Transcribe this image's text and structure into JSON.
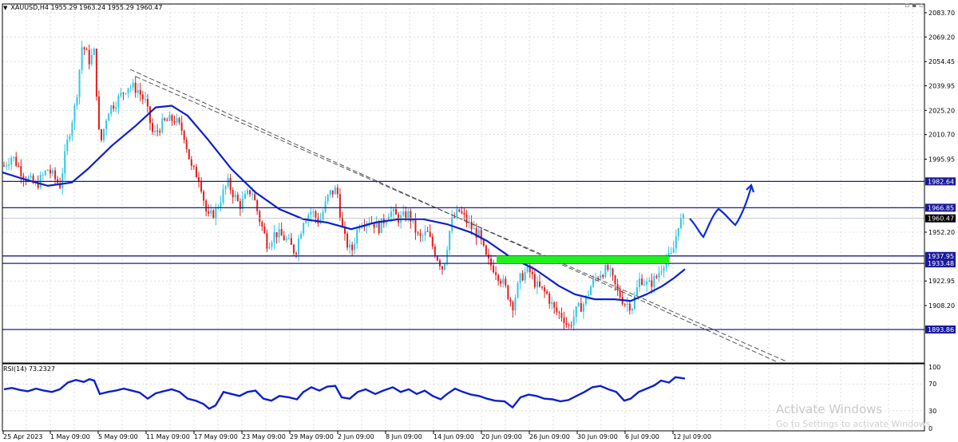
{
  "window": {
    "menu_arrow": "▼",
    "symbol_info": "XAUUSD,H4  1955.29 1963.24 1955.29 1960.47",
    "window_controls": "▫ ▪ ▫",
    "rsi_label": "RSI(14) 73.2327"
  },
  "price_axis": {
    "labels": [
      "2083.70",
      "2069.20",
      "2054.45",
      "2039.95",
      "2025.20",
      "2010.70",
      "1995.95",
      "1952.20",
      "1922.95",
      "1908.20"
    ],
    "values": [
      2083.7,
      2069.2,
      2054.45,
      2039.95,
      2025.2,
      2010.7,
      1995.95,
      1952.2,
      1922.95,
      1908.2
    ]
  },
  "rsi_axis": {
    "labels": [
      "100",
      "70",
      "30",
      "0"
    ],
    "values": [
      100,
      70,
      30,
      0
    ]
  },
  "time_axis": {
    "labels": [
      "25 Apr 2023",
      "1 May 09:00",
      "5 May 09:00",
      "11 May 09:00",
      "17 May 09:00",
      "23 May 09:00",
      "29 May 09:00",
      "2 Jun 09:00",
      "8 Jun 09:00",
      "14 Jun 09:00",
      "20 Jun 09:00",
      "26 Jun 09:00",
      "30 Jun 09:00",
      "6 Jul 09:00",
      "12 Jul 09:00"
    ]
  },
  "levels": [
    {
      "label": "1982.64",
      "value": 1982.64
    },
    {
      "label": "1966.85",
      "value": 1966.85
    },
    {
      "label": "1937.95",
      "value": 1937.95
    },
    {
      "label": "1933.48",
      "value": 1933.48
    },
    {
      "label": "1893.86",
      "value": 1893.86
    }
  ],
  "current_price": {
    "label": "1960.47",
    "value": 1960.47
  },
  "colors": {
    "bull": "#2fc7e6",
    "bear": "#e01e1e",
    "ma": "#0a1fcf",
    "level_line": "#1a1a9c",
    "zone": "#22f01e",
    "arrow": "#0a2ce0",
    "grid": "#c8c8c8"
  },
  "watermark": {
    "title": "Activate Windows",
    "subtitle": "Go to Settings to activate Windows."
  }
}
